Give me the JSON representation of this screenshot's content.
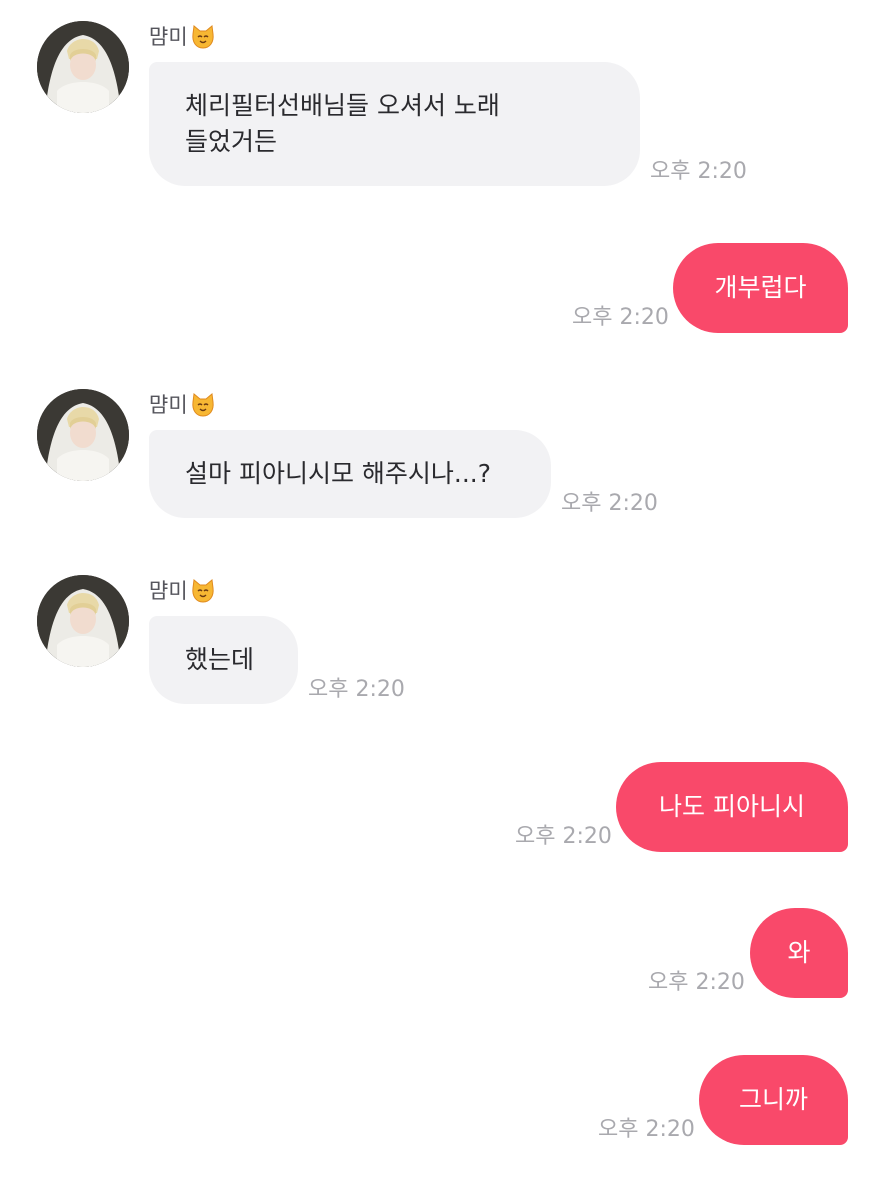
{
  "sender": {
    "name": "먐미",
    "emoji_icon": "smiling-cat-face-icon"
  },
  "messages": [
    {
      "direction": "incoming",
      "text": "체리필터선배님들 오셔서 노래\n들었거든",
      "time": "오후 2:20"
    },
    {
      "direction": "outgoing",
      "text": "개부럽다",
      "time": "오후 2:20"
    },
    {
      "direction": "incoming",
      "text": "설마 피아니시모 해주시나...?",
      "time": "오후 2:20"
    },
    {
      "direction": "incoming",
      "text": "했는데",
      "time": "오후 2:20"
    },
    {
      "direction": "outgoing",
      "text": "나도 피아니시",
      "time": "오후 2:20"
    },
    {
      "direction": "outgoing",
      "text": "와",
      "time": "오후 2:20"
    },
    {
      "direction": "outgoing",
      "text": "그니까",
      "time": "오후 2:20"
    }
  ],
  "colors": {
    "outgoing_bubble": "#f9496a",
    "incoming_bubble": "#f2f2f4",
    "timestamp": "#a9a9ae"
  }
}
